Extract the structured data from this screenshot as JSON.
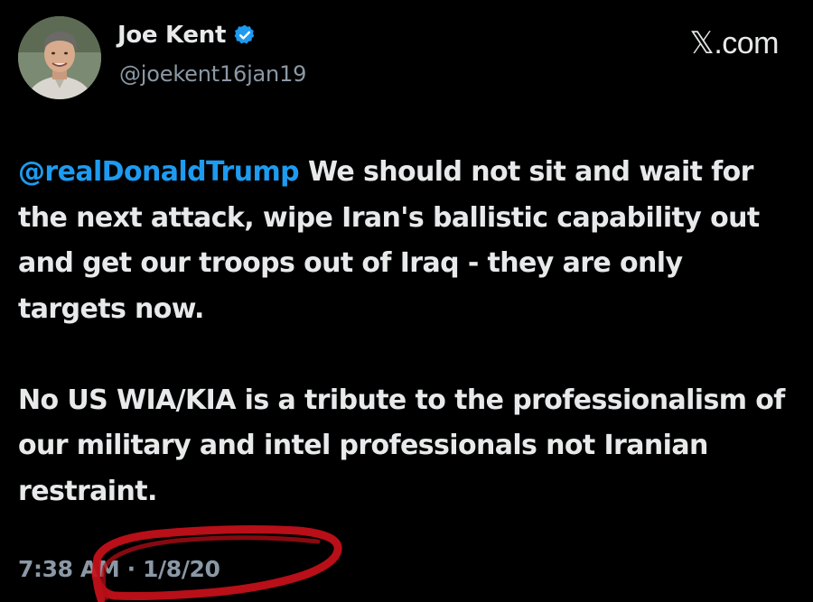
{
  "author": {
    "display_name": "Joe Kent",
    "handle": "@joekent16jan19",
    "verified": true
  },
  "site": {
    "label": "𝕏.com"
  },
  "tweet": {
    "mention": "@realDonaldTrump",
    "paragraph1_rest": "We should not sit and wait for the next attack, wipe Iran's ballistic capability out and get our troops out of Iraq - they are only targets now.",
    "paragraph2": "No US WIA/KIA is a tribute to the professionalism of our military and intel professionals not Iranian restraint."
  },
  "meta": {
    "time": "7:38 AM",
    "separator": "·",
    "date": "1/8/20"
  },
  "colors": {
    "background": "#000000",
    "text": "#e7e9ea",
    "secondary": "#8b98a5",
    "link": "#1d9bf0",
    "annotation": "#c8101a"
  }
}
